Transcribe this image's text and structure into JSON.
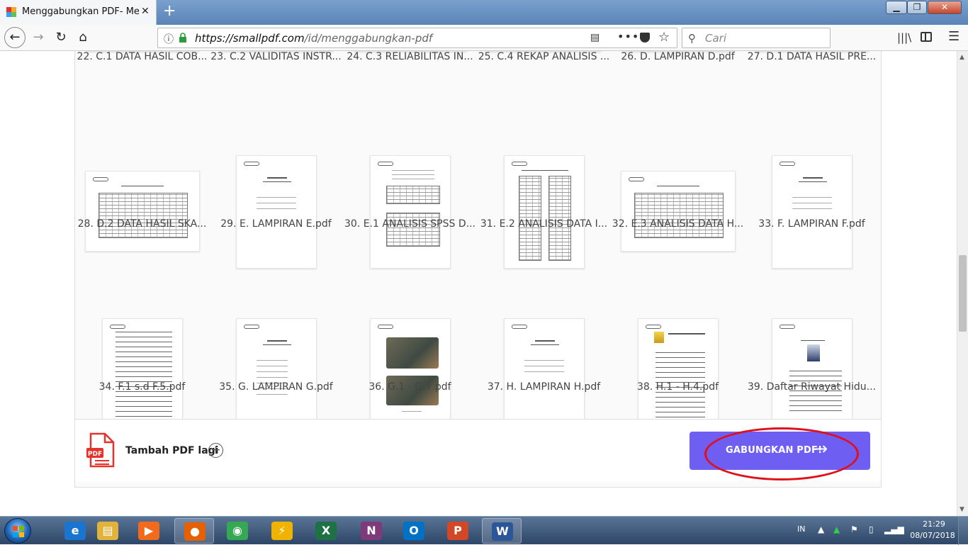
{
  "browser": {
    "tab_title": "Menggabungkan PDF- Menggabungkan",
    "tab_close": "✕",
    "new_tab": "+",
    "url_host": "https://smallpdf.com",
    "url_path": "/id/menggabungkan-pdf",
    "search_placeholder": "Cari",
    "win_min": "▁",
    "win_max": "❐",
    "win_close": "✕"
  },
  "files": [
    {
      "name": "22. C.1 DATA HASIL COB..."
    },
    {
      "name": "23. C.2 VALIDITAS INSTR..."
    },
    {
      "name": "24. C.3 RELIABILITAS IN..."
    },
    {
      "name": "25. C.4 REKAP ANALISIS ..."
    },
    {
      "name": "26. D. LAMPIRAN D.pdf"
    },
    {
      "name": "27. D.1 DATA HASIL PRE..."
    },
    {
      "name": "28. D.2 DATA HASIL SKA..."
    },
    {
      "name": "29. E. LAMPIRAN E.pdf"
    },
    {
      "name": "30. E.1 ANALISIS SPSS D..."
    },
    {
      "name": "31. E.2 ANALISIS DATA I..."
    },
    {
      "name": "32. E.3 ANALISIS DATA H..."
    },
    {
      "name": "33. F. LAMPIRAN F.pdf"
    },
    {
      "name": "34. F.1 s.d F.5.pdf"
    },
    {
      "name": "35. G. LAMPIRAN G.pdf"
    },
    {
      "name": "36. G.1 - G.7.pdf"
    },
    {
      "name": "37. H. LAMPIRAN H.pdf"
    },
    {
      "name": "38. H.1 - H.4.pdf"
    },
    {
      "name": "39. Daftar Riwayat Hidu..."
    }
  ],
  "action_bar": {
    "add_more_label": "Tambah PDF lagi",
    "merge_button_label": "GABUNGKAN PDF!",
    "pdf_icon_text": "PDF"
  },
  "taskbar": {
    "language": "IN",
    "time": "21:29",
    "date": "08/07/2018",
    "apps": [
      "internet-explorer",
      "file-explorer",
      "media-player",
      "firefox",
      "chrome",
      "winamp",
      "excel",
      "onenote",
      "outlook",
      "powerpoint",
      "word"
    ]
  },
  "colors": {
    "merge_button": "#6e5ef2",
    "highlight_ellipse": "#e0101a",
    "pdf_icon": "#e5322d"
  }
}
